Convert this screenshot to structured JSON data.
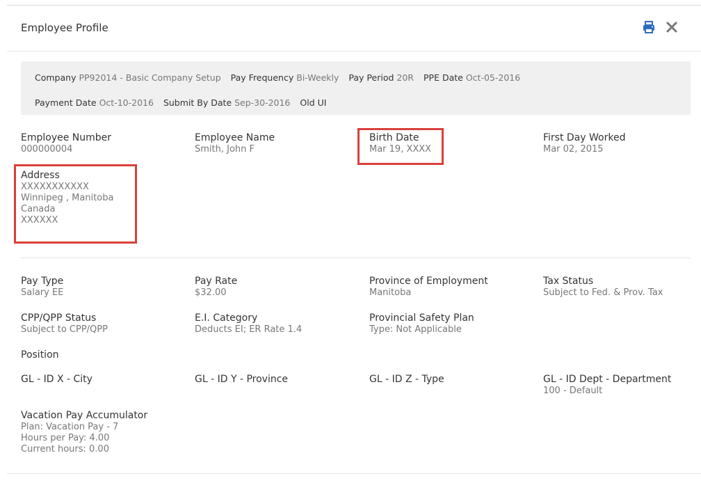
{
  "header": {
    "title": "Employee Profile",
    "print_icon": "print-icon",
    "close_icon": "close-icon",
    "accent_color": "#2f6dbf"
  },
  "info_bar": {
    "company_label": "Company",
    "company_value": "PP92014 - Basic Company Setup",
    "pay_frequency_label": "Pay Frequency",
    "pay_frequency_value": "Bi-Weekly",
    "pay_period_label": "Pay Period",
    "pay_period_value": "20R",
    "ppe_date_label": "PPE Date",
    "ppe_date_value": "Oct-05-2016",
    "payment_date_label": "Payment Date",
    "payment_date_value": "Oct-10-2016",
    "submit_by_label": "Submit By Date",
    "submit_by_value": "Sep-30-2016",
    "old_ui_label": "Old UI"
  },
  "employee": {
    "number_label": "Employee Number",
    "number_value": "000000004",
    "name_label": "Employee Name",
    "name_value": "Smith, John F",
    "birth_label": "Birth Date",
    "birth_value": "Mar 19, XXXX",
    "first_day_label": "First Day Worked",
    "first_day_value": "Mar 02, 2015",
    "address_label": "Address",
    "address_lines": [
      "XXXXXXXXXXX",
      "Winnipeg , Manitoba",
      "Canada",
      "XXXXXX"
    ]
  },
  "pay": {
    "pay_type_label": "Pay Type",
    "pay_type_value": "Salary EE",
    "pay_rate_label": "Pay Rate",
    "pay_rate_value": "$32.00",
    "province_label": "Province of Employment",
    "province_value": "Manitoba",
    "tax_status_label": "Tax Status",
    "tax_status_value": "Subject to Fed. & Prov. Tax",
    "cpp_label": "CPP/QPP Status",
    "cpp_value": "Subject to CPP/QPP",
    "ei_label": "E.I. Category",
    "ei_value": "Deducts EI; ER Rate 1.4",
    "safety_label": "Provincial Safety Plan",
    "safety_value": "Type: Not Applicable",
    "position_label": "Position",
    "gl_x_label": "GL - ID X - City",
    "gl_y_label": "GL - ID Y - Province",
    "gl_z_label": "GL - ID Z - Type",
    "gl_dept_label": "GL - ID Dept - Department",
    "gl_dept_value": "100 - Default",
    "vacation_label": "Vacation Pay Accumulator",
    "vacation_lines": [
      "Plan: Vacation Pay - 7",
      "Hours per Pay: 4.00",
      "Current hours: 0.00"
    ]
  },
  "highlight_color": "#d9403a"
}
